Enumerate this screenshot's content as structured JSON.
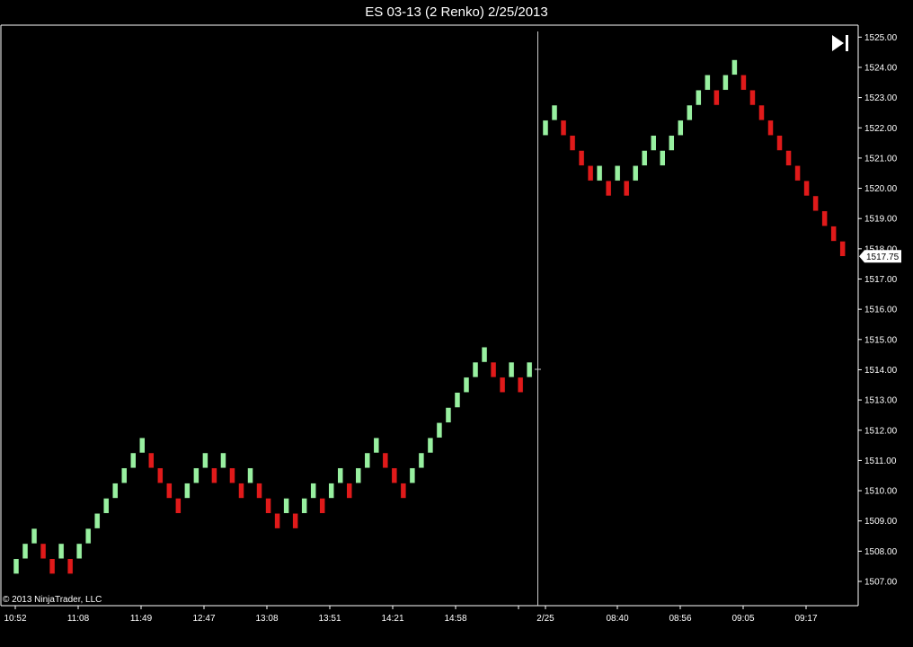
{
  "title": "ES 03-13 (2 Renko)  2/25/2013",
  "copyright": "© 2013 NinjaTrader, LLC",
  "end_button_icon": "skip-to-end-icon",
  "colors": {
    "background": "#000000",
    "up_brick": "#98f0a0",
    "down_brick": "#e01a1a",
    "axis": "#ffffff",
    "price_tag_bg": "#ffffff"
  },
  "chart_data": {
    "type": "renko",
    "brick_size": 0.5,
    "ylim": [
      1506.6,
      1525.2
    ],
    "y_ticks": [
      "1507.00",
      "1508.00",
      "1509.00",
      "1510.00",
      "1511.00",
      "1512.00",
      "1513.00",
      "1514.00",
      "1515.00",
      "1516.00",
      "1517.00",
      "1518.00",
      "1519.00",
      "1520.00",
      "1521.00",
      "1522.00",
      "1523.00",
      "1524.00",
      "1525.00"
    ],
    "x_labels": [
      "10:52",
      "11:08",
      "11:49",
      "12:47",
      "13:08",
      "13:51",
      "14:21",
      "14:58",
      "2/25",
      "08:40",
      "08:56",
      "09:05",
      "09:17"
    ],
    "session_break_label": "2/25",
    "last_price": "1517.75",
    "bricks": [
      {
        "o": 1507.25,
        "c": 1507.75
      },
      {
        "o": 1507.75,
        "c": 1508.25
      },
      {
        "o": 1508.25,
        "c": 1508.75
      },
      {
        "o": 1508.25,
        "c": 1507.75
      },
      {
        "o": 1507.75,
        "c": 1507.25
      },
      {
        "o": 1507.75,
        "c": 1508.25
      },
      {
        "o": 1507.75,
        "c": 1507.25
      },
      {
        "o": 1507.75,
        "c": 1508.25
      },
      {
        "o": 1508.25,
        "c": 1508.75
      },
      {
        "o": 1508.75,
        "c": 1509.25
      },
      {
        "o": 1509.25,
        "c": 1509.75
      },
      {
        "o": 1509.75,
        "c": 1510.25
      },
      {
        "o": 1510.25,
        "c": 1510.75
      },
      {
        "o": 1510.75,
        "c": 1511.25
      },
      {
        "o": 1511.25,
        "c": 1511.75
      },
      {
        "o": 1511.25,
        "c": 1510.75
      },
      {
        "o": 1510.75,
        "c": 1510.25
      },
      {
        "o": 1510.25,
        "c": 1509.75
      },
      {
        "o": 1509.75,
        "c": 1509.25
      },
      {
        "o": 1509.75,
        "c": 1510.25
      },
      {
        "o": 1510.25,
        "c": 1510.75
      },
      {
        "o": 1510.75,
        "c": 1511.25
      },
      {
        "o": 1510.75,
        "c": 1510.25
      },
      {
        "o": 1510.75,
        "c": 1511.25
      },
      {
        "o": 1510.75,
        "c": 1510.25
      },
      {
        "o": 1510.25,
        "c": 1509.75
      },
      {
        "o": 1510.25,
        "c": 1510.75
      },
      {
        "o": 1510.25,
        "c": 1509.75
      },
      {
        "o": 1509.75,
        "c": 1509.25
      },
      {
        "o": 1509.25,
        "c": 1508.75
      },
      {
        "o": 1509.25,
        "c": 1509.75
      },
      {
        "o": 1509.25,
        "c": 1508.75
      },
      {
        "o": 1509.25,
        "c": 1509.75
      },
      {
        "o": 1509.75,
        "c": 1510.25
      },
      {
        "o": 1509.75,
        "c": 1509.25
      },
      {
        "o": 1509.75,
        "c": 1510.25
      },
      {
        "o": 1510.25,
        "c": 1510.75
      },
      {
        "o": 1510.25,
        "c": 1509.75
      },
      {
        "o": 1510.25,
        "c": 1510.75
      },
      {
        "o": 1510.75,
        "c": 1511.25
      },
      {
        "o": 1511.25,
        "c": 1511.75
      },
      {
        "o": 1511.25,
        "c": 1510.75
      },
      {
        "o": 1510.75,
        "c": 1510.25
      },
      {
        "o": 1510.25,
        "c": 1509.75
      },
      {
        "o": 1510.25,
        "c": 1510.75
      },
      {
        "o": 1510.75,
        "c": 1511.25
      },
      {
        "o": 1511.25,
        "c": 1511.75
      },
      {
        "o": 1511.75,
        "c": 1512.25
      },
      {
        "o": 1512.25,
        "c": 1512.75
      },
      {
        "o": 1512.75,
        "c": 1513.25
      },
      {
        "o": 1513.25,
        "c": 1513.75
      },
      {
        "o": 1513.75,
        "c": 1514.25
      },
      {
        "o": 1514.25,
        "c": 1514.75
      },
      {
        "o": 1514.25,
        "c": 1513.75
      },
      {
        "o": 1513.75,
        "c": 1513.25
      },
      {
        "o": 1513.75,
        "c": 1514.25
      },
      {
        "o": 1513.75,
        "c": 1513.25
      },
      {
        "o": 1513.75,
        "c": 1514.25
      },
      {
        "o": 1521.75,
        "c": 1522.25
      },
      {
        "o": 1522.25,
        "c": 1522.75
      },
      {
        "o": 1522.25,
        "c": 1521.75
      },
      {
        "o": 1521.75,
        "c": 1521.25
      },
      {
        "o": 1521.25,
        "c": 1520.75
      },
      {
        "o": 1520.75,
        "c": 1520.25
      },
      {
        "o": 1520.25,
        "c": 1520.75
      },
      {
        "o": 1520.25,
        "c": 1519.75
      },
      {
        "o": 1520.25,
        "c": 1520.75
      },
      {
        "o": 1520.25,
        "c": 1519.75
      },
      {
        "o": 1520.25,
        "c": 1520.75
      },
      {
        "o": 1520.75,
        "c": 1521.25
      },
      {
        "o": 1521.25,
        "c": 1521.75
      },
      {
        "o": 1520.75,
        "c": 1521.25
      },
      {
        "o": 1521.25,
        "c": 1521.75
      },
      {
        "o": 1521.75,
        "c": 1522.25
      },
      {
        "o": 1522.25,
        "c": 1522.75
      },
      {
        "o": 1522.75,
        "c": 1523.25
      },
      {
        "o": 1523.25,
        "c": 1523.75
      },
      {
        "o": 1523.25,
        "c": 1522.75
      },
      {
        "o": 1523.25,
        "c": 1523.75
      },
      {
        "o": 1523.75,
        "c": 1524.25
      },
      {
        "o": 1523.75,
        "c": 1523.25
      },
      {
        "o": 1523.25,
        "c": 1522.75
      },
      {
        "o": 1522.75,
        "c": 1522.25
      },
      {
        "o": 1522.25,
        "c": 1521.75
      },
      {
        "o": 1521.75,
        "c": 1521.25
      },
      {
        "o": 1521.25,
        "c": 1520.75
      },
      {
        "o": 1520.75,
        "c": 1520.25
      },
      {
        "o": 1520.25,
        "c": 1519.75
      },
      {
        "o": 1519.75,
        "c": 1519.25
      },
      {
        "o": 1519.25,
        "c": 1518.75
      },
      {
        "o": 1518.75,
        "c": 1518.25
      },
      {
        "o": 1518.25,
        "c": 1517.75
      }
    ]
  }
}
